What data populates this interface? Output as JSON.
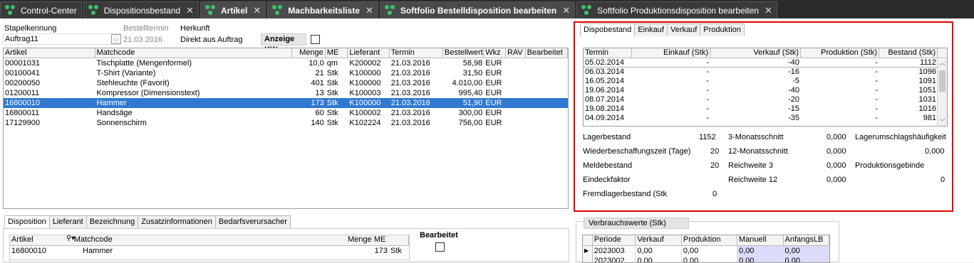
{
  "tabs": [
    {
      "label": "Control-Center",
      "bold": false,
      "close": false
    },
    {
      "label": "Dispositionsbestand",
      "bold": false,
      "close": true
    },
    {
      "label": "Artikel",
      "bold": true,
      "close": true
    },
    {
      "label": "Machbarkeitsliste",
      "bold": true,
      "close": true
    },
    {
      "label": "Softfolio Bestelldisposition bearbeiten",
      "bold": true,
      "close": true
    },
    {
      "label": "Softfolio Produktionsdisposition bearbeiten",
      "bold": false,
      "close": true
    }
  ],
  "header": {
    "stapel_label": "Stapelkennung",
    "stapel_value": "Auftrag11",
    "bestell_label": "Bestelltermin",
    "bestell_value": "21.03.2016",
    "herkunft_label": "Herkunft",
    "herkunft_value": "Direkt aus Auftrag",
    "anzeige_kw": "Anzeige KW"
  },
  "articles": {
    "columns": [
      "Artikel",
      "Matchcode",
      "Menge",
      "ME",
      "Lieferant",
      "Termin",
      "Bestellwert",
      "Wkz",
      "RAV",
      "Bearbeitet"
    ],
    "rows": [
      [
        "00001031",
        "Tischplatte (Mengenformel)",
        "10,0",
        "qm",
        "K200002",
        "21.03.2016",
        "58,98",
        "EUR",
        "",
        ""
      ],
      [
        "00100041",
        "T-Shirt (Variante)",
        "21",
        "Stk",
        "K100000",
        "21.03.2016",
        "31,50",
        "EUR",
        "",
        ""
      ],
      [
        "00200050",
        "Stehleuchte  (Favorit)",
        "401",
        "Stk",
        "K100000",
        "21.03.2016",
        "4.010,00",
        "EUR",
        "",
        ""
      ],
      [
        "01200011",
        "Kompressor (Dimensionstext)",
        "13",
        "Stk",
        "K100003",
        "21.03.2016",
        "995,40",
        "EUR",
        "",
        ""
      ],
      [
        "16800010",
        "Hammer",
        "173",
        "Stk",
        "K100000",
        "21.03.2016",
        "51,90",
        "EUR",
        "",
        ""
      ],
      [
        "16800011",
        "Handsäge",
        "60",
        "Stk",
        "K100002",
        "21.03.2016",
        "300,00",
        "EUR",
        "",
        ""
      ],
      [
        "17129900",
        "Sonnenschirm",
        "140",
        "Stk",
        "K102224",
        "21.03.2016",
        "756,00",
        "EUR",
        "",
        ""
      ]
    ],
    "selected_index": 4
  },
  "bottom": {
    "tabs": [
      "Disposition",
      "Lieferant",
      "Bezeichnung",
      "Zusatzinformationen",
      "Bedarfsverursacher"
    ],
    "columns": [
      "Artikel",
      "Matchcode",
      "Menge ME"
    ],
    "row": {
      "artikel": "16800010",
      "matchcode": "Hammer",
      "menge": "173",
      "me": "Stk"
    },
    "bearbeitet": "Bearbeitet"
  },
  "disposition": {
    "tabs": [
      "Dispobestand",
      "Einkauf",
      "Verkauf",
      "Produktion"
    ],
    "columns": [
      "Termin",
      "Einkauf (Stk)",
      "Verkauf (Stk)",
      "Produktion (Stk)",
      "Bestand (Stk)"
    ],
    "rows": [
      [
        "05.02.2014",
        "-",
        "-40",
        "-",
        "1112"
      ],
      [
        "06.03.2014",
        "-",
        "-16",
        "-",
        "1096"
      ],
      [
        "16.05.2014",
        "-",
        "-5",
        "-",
        "1091"
      ],
      [
        "19.06.2014",
        "-",
        "-40",
        "-",
        "1051"
      ],
      [
        "08.07.2014",
        "-",
        "-20",
        "-",
        "1031"
      ],
      [
        "19.08.2014",
        "-",
        "-15",
        "-",
        "1016"
      ],
      [
        "04.09.2014",
        "-",
        "-35",
        "-",
        "981"
      ]
    ],
    "stats": {
      "lagerbestand_label": "Lagerbestand",
      "lagerbestand": "1152",
      "wbz_label": "Wiederbeschaffungszeit (Tage)",
      "wbz": "20",
      "meldebestand_label": "Meldebestand",
      "meldebestand": "20",
      "eindeck_label": "Eindeckfaktor",
      "fremd_label": "Fremdlagerbestand (Stk",
      "fremd": "0",
      "m3_label": "3-Monatsschnitt",
      "m3": "0,000",
      "m12_label": "12-Monatsschnitt",
      "m12": "0,000",
      "rw3_label": "Reichweite 3",
      "rw3": "0,000",
      "rw12_label": "Reichweite 12",
      "rw12": "0,000",
      "lu_label": "Lagerumschlagshäufigkeit",
      "lu": "0,000",
      "pg_label": "Produktionsgebinde",
      "pg": "0"
    }
  },
  "verbrauch": {
    "title": "Verbrauchswerte (Stk)",
    "columns": [
      "Periode",
      "Verkauf",
      "Produktion",
      "Manuell",
      "AnfangsLB"
    ],
    "rows": [
      [
        "2023003",
        "0,00",
        "0,00",
        "0,00",
        "0,00"
      ],
      [
        "2023002",
        "0,00",
        "0,00",
        "0,00",
        "0,00"
      ]
    ]
  }
}
